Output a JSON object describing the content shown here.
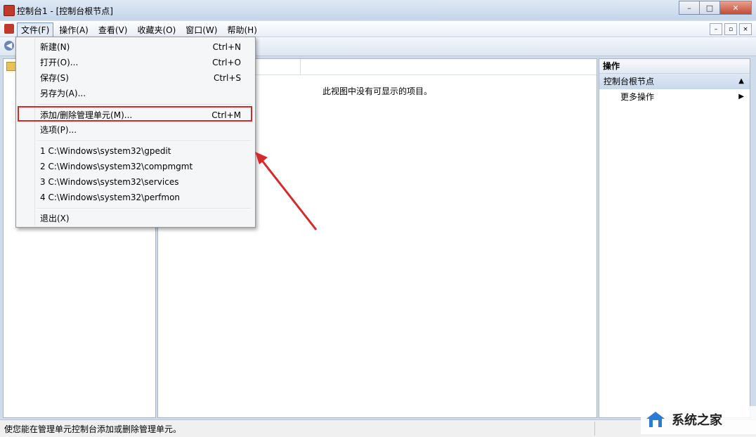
{
  "window": {
    "title": "控制台1 - [控制台根节点]",
    "minimize": "–",
    "maximize": "□",
    "close": "✕"
  },
  "menubar": {
    "items": [
      "文件(F)",
      "操作(A)",
      "查看(V)",
      "收藏夹(O)",
      "窗口(W)",
      "帮助(H)"
    ],
    "active": "文件(F)",
    "mdi": [
      "–",
      "▫",
      "×"
    ]
  },
  "file_menu": {
    "items": [
      {
        "label": "新建(N)",
        "shortcut": "Ctrl+N"
      },
      {
        "label": "打开(O)...",
        "shortcut": "Ctrl+O"
      },
      {
        "label": "保存(S)",
        "shortcut": "Ctrl+S"
      },
      {
        "label": "另存为(A)...",
        "shortcut": ""
      },
      {
        "label": "添加/删除管理单元(M)...",
        "shortcut": "Ctrl+M"
      },
      {
        "label": "选项(P)...",
        "shortcut": ""
      },
      {
        "label": "1 C:\\Windows\\system32\\gpedit",
        "shortcut": ""
      },
      {
        "label": "2 C:\\Windows\\system32\\compmgmt",
        "shortcut": ""
      },
      {
        "label": "3 C:\\Windows\\system32\\services",
        "shortcut": ""
      },
      {
        "label": "4 C:\\Windows\\system32\\perfmon",
        "shortcut": ""
      },
      {
        "label": "退出(X)",
        "shortcut": ""
      }
    ],
    "highlighted_label": "添加/删除管理单元(M)..."
  },
  "center": {
    "empty_message": "此视图中没有可显示的项目。"
  },
  "actions": {
    "header": "操作",
    "section": "控制台根节点",
    "item": "更多操作"
  },
  "statusbar": {
    "text": "使您能在管理单元控制台添加或删除管理单元。"
  },
  "watermark": {
    "text": "系统之家"
  },
  "colors": {
    "highlight_border": "#d02a2a",
    "annotation_arrow": "#d62a2a"
  }
}
